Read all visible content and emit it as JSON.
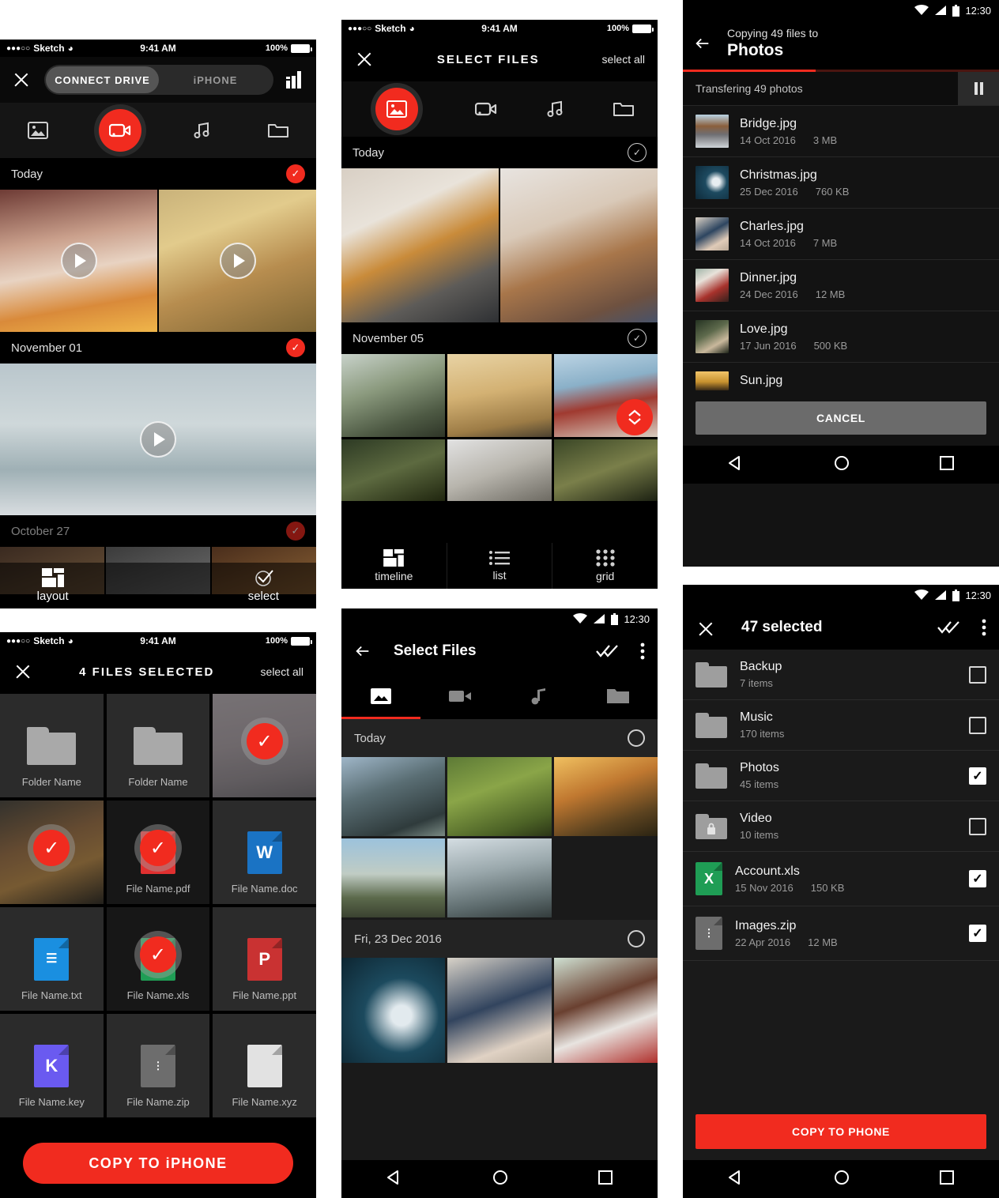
{
  "ios_status": {
    "carrier": "Sketch",
    "dots": "●●●○○",
    "time": "9:41 AM",
    "battery": "100%"
  },
  "android_status": {
    "time": "12:30"
  },
  "panel1": {
    "segments": [
      {
        "label": "CONNECT DRIVE",
        "active": true
      },
      {
        "label": "iPHONE",
        "active": false
      }
    ],
    "tabs": [
      {
        "name": "photo-tab",
        "icon": "image-icon",
        "active": false
      },
      {
        "name": "video-tab",
        "icon": "video-icon",
        "active": true
      },
      {
        "name": "music-tab",
        "icon": "music-icon",
        "active": false
      },
      {
        "name": "folder-tab",
        "icon": "folder-icon",
        "active": false
      }
    ],
    "sections": [
      {
        "label": "Today",
        "checked": true
      },
      {
        "label": "November 01",
        "checked": true
      },
      {
        "label": "October 27",
        "checked": true
      }
    ],
    "bottom": [
      {
        "label": "layout",
        "icon": "layout-icon"
      },
      {
        "label": "",
        "icon": ""
      },
      {
        "label": "select",
        "icon": "select-check-icon"
      }
    ]
  },
  "panel2": {
    "title": "SELECT FILES",
    "select_all": "select all",
    "tabs": [
      {
        "name": "photo-tab",
        "icon": "image-icon",
        "active": true
      },
      {
        "name": "video-tab",
        "icon": "video-icon",
        "active": false
      },
      {
        "name": "music-tab",
        "icon": "music-icon",
        "active": false
      },
      {
        "name": "folder-tab",
        "icon": "folder-icon",
        "active": false
      }
    ],
    "sections": [
      {
        "label": "Today",
        "checked": false
      },
      {
        "label": "November 05",
        "checked": false
      }
    ],
    "bottom": [
      {
        "label": "timeline",
        "icon": "layout-icon",
        "active": true
      },
      {
        "label": "list",
        "icon": "list-icon",
        "active": false
      },
      {
        "label": "grid",
        "icon": "grid-icon",
        "active": false
      }
    ]
  },
  "panel3": {
    "subtitle": "Copying 49 files to",
    "title": "Photos",
    "progress_percent": 42,
    "transfer_label": "Transfering 49 photos",
    "pause_icon": "pause-icon",
    "files": [
      {
        "name": "Bridge.jpg",
        "date": "14 Oct 2016",
        "size": "3 MB"
      },
      {
        "name": "Christmas.jpg",
        "date": "25 Dec 2016",
        "size": "760 KB"
      },
      {
        "name": "Charles.jpg",
        "date": "14 Oct 2016",
        "size": "7 MB"
      },
      {
        "name": "Dinner.jpg",
        "date": "24 Dec 2016",
        "size": "12 MB"
      },
      {
        "name": "Love.jpg",
        "date": "17 Jun 2016",
        "size": "500 KB"
      },
      {
        "name": "Sun.jpg",
        "date": "",
        "size": ""
      }
    ],
    "cancel_label": "CANCEL"
  },
  "panel4": {
    "title": "4 FILES SELECTED",
    "select_all": "select all",
    "cells": [
      {
        "label": "Folder Name",
        "kind": "folder",
        "selected": false
      },
      {
        "label": "Folder Name",
        "kind": "folder",
        "selected": false
      },
      {
        "label": "",
        "kind": "photo",
        "selected": true
      },
      {
        "label": "",
        "kind": "photo",
        "selected": true
      },
      {
        "label": "File Name.pdf",
        "kind": "doc",
        "letter": "",
        "color": "#e03030",
        "selected": true
      },
      {
        "label": "File Name.doc",
        "kind": "doc",
        "letter": "W",
        "color": "#1a73c4",
        "selected": false
      },
      {
        "label": "File Name.txt",
        "kind": "doc",
        "letter": "≡",
        "color": "#1a8fe0",
        "selected": false
      },
      {
        "label": "File Name.xls",
        "kind": "doc",
        "letter": "X",
        "color": "#1f9d55",
        "selected": true
      },
      {
        "label": "File Name.ppt",
        "kind": "doc",
        "letter": "P",
        "color": "#c93232",
        "selected": false
      },
      {
        "label": "File Name.key",
        "kind": "doc",
        "letter": "K",
        "color": "#6a5af0",
        "selected": false
      },
      {
        "label": "File Name.zip",
        "kind": "doc",
        "letter": "⋮",
        "color": "#6d6d6d",
        "selected": false
      },
      {
        "label": "File Name.xyz",
        "kind": "doc",
        "letter": "",
        "color": "#e2e2e2",
        "selected": false
      }
    ],
    "copy_label": "COPY TO iPHONE"
  },
  "panel5": {
    "title": "Select Files",
    "tabs": [
      {
        "name": "photo-tab",
        "icon": "image-icon",
        "active": true
      },
      {
        "name": "video-tab",
        "icon": "video-icon",
        "active": false
      },
      {
        "name": "music-tab",
        "icon": "music-icon",
        "active": false
      },
      {
        "name": "folder-tab",
        "icon": "folder-icon",
        "active": false
      }
    ],
    "sections": [
      {
        "label": "Today",
        "checked": false
      },
      {
        "label": "Fri, 23 Dec 2016",
        "checked": false
      }
    ]
  },
  "panel6": {
    "title": "47 selected",
    "rows": [
      {
        "name": "Backup",
        "sub": "7 items",
        "date": "",
        "size": "",
        "kind": "folder",
        "checked": false
      },
      {
        "name": "Music",
        "sub": "170 items",
        "date": "",
        "size": "",
        "kind": "folder",
        "checked": false
      },
      {
        "name": "Photos",
        "sub": "45 items",
        "date": "",
        "size": "",
        "kind": "folder",
        "checked": true
      },
      {
        "name": "Video",
        "sub": "10 items",
        "date": "",
        "size": "",
        "kind": "folder-lock",
        "checked": false
      },
      {
        "name": "Account.xls",
        "sub": "",
        "date": "15 Nov 2016",
        "size": "150 KB",
        "kind": "xls",
        "checked": true
      },
      {
        "name": "Images.zip",
        "sub": "",
        "date": "22 Apr 2016",
        "size": "12 MB",
        "kind": "zip",
        "checked": true
      }
    ],
    "copy_label": "COPY TO PHONE"
  },
  "colors": {
    "accent": "#f12b1f",
    "bg_dark": "#000000",
    "panel_bg": "#1a1a1a",
    "green": "#1f9d55",
    "blue": "#1a73c4"
  }
}
